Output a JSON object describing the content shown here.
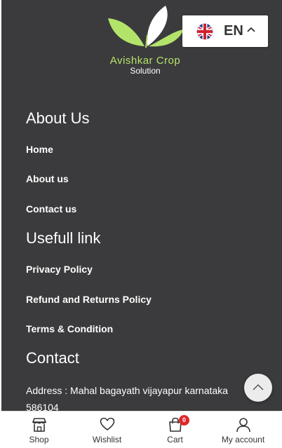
{
  "brand": {
    "name": "Avishkar Crop",
    "subtitle": "Solution",
    "logo_icon": "leaves-icon",
    "accent_color": "#b4e36a"
  },
  "language": {
    "code": "EN",
    "flag_icon": "uk-flag-icon"
  },
  "sections": {
    "about": {
      "title": "About Us",
      "links": [
        "Home",
        "About us",
        "Contact us"
      ]
    },
    "useful": {
      "title": "Usefull link",
      "links": [
        "Privacy Policy",
        "Refund and Returns Policy",
        "Terms & Condition"
      ]
    },
    "contact": {
      "title": "Contact",
      "address": "Address : Mahal bagayath vijayapur karnataka 586104"
    }
  },
  "bottom_nav": {
    "items": [
      {
        "label": "Shop",
        "icon": "shop-icon"
      },
      {
        "label": "Wishlist",
        "icon": "heart-icon"
      },
      {
        "label": "Cart",
        "icon": "cart-bag-icon",
        "badge": "0"
      },
      {
        "label": "My account",
        "icon": "user-icon"
      }
    ]
  },
  "colors": {
    "footer_bg": "#3b3b3d",
    "badge": "#e0262b"
  }
}
